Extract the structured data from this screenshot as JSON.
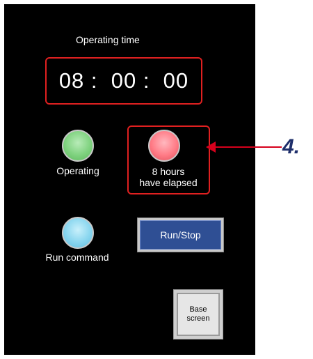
{
  "display": {
    "title": "Operating time",
    "time": {
      "hours": "08",
      "minutes": "00",
      "seconds": "00",
      "text": "08 :  00 :  00"
    }
  },
  "lamps": [
    {
      "id": "operating",
      "label": "Operating",
      "color": "#7fd27f",
      "state": "on"
    },
    {
      "id": "elapsed",
      "label_line1": "8 hours",
      "label_line2": "have elapsed",
      "color": "#ff7b86",
      "state": "on"
    },
    {
      "id": "run-command",
      "label": "Run command",
      "color": "#89d6ef",
      "state": "on"
    }
  ],
  "buttons": {
    "run_stop": {
      "label": "Run/Stop",
      "color": "#2f4f94"
    },
    "base_screen": {
      "label_line1": "Base",
      "label_line2": "screen"
    }
  },
  "callout": {
    "label": "4.",
    "color": "#d6001c"
  }
}
